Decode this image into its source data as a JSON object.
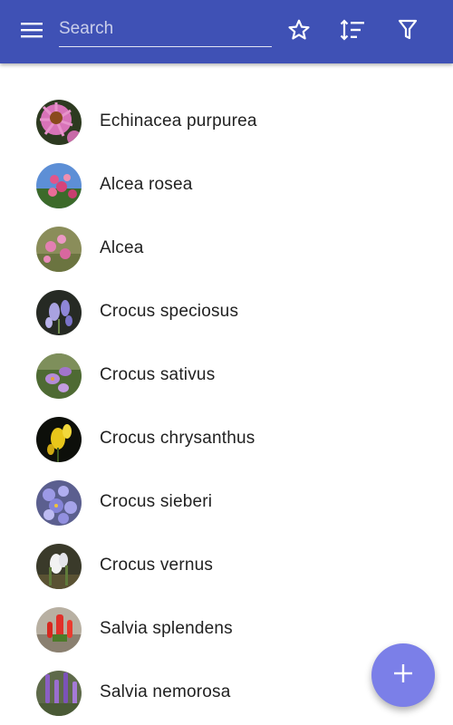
{
  "toolbar": {
    "search_placeholder": "Search",
    "background_color": "#3f51b5",
    "icons": {
      "menu": "menu-icon",
      "favorites": "star-outline-icon",
      "sort": "sort-icon",
      "filter": "filter-icon"
    }
  },
  "plants": [
    {
      "name": "Echinacea purpurea",
      "photo": "pink-coneflower"
    },
    {
      "name": "Alcea rosea",
      "photo": "pink-hollyhock-sky"
    },
    {
      "name": "Alcea",
      "photo": "pink-flowers-grass"
    },
    {
      "name": "Crocus speciosus",
      "photo": "lilac-crocus"
    },
    {
      "name": "Crocus sativus",
      "photo": "purple-crocus-grass"
    },
    {
      "name": "Crocus chrysanthus",
      "photo": "yellow-crocus"
    },
    {
      "name": "Crocus sieberi",
      "photo": "violet-crocus-cluster"
    },
    {
      "name": "Crocus vernus",
      "photo": "white-crocus"
    },
    {
      "name": "Salvia splendens",
      "photo": "red-salvia"
    },
    {
      "name": "Salvia nemorosa",
      "photo": "purple-salvia"
    }
  ],
  "fab": {
    "icon": "plus-icon",
    "color": "#7b7fe8"
  }
}
